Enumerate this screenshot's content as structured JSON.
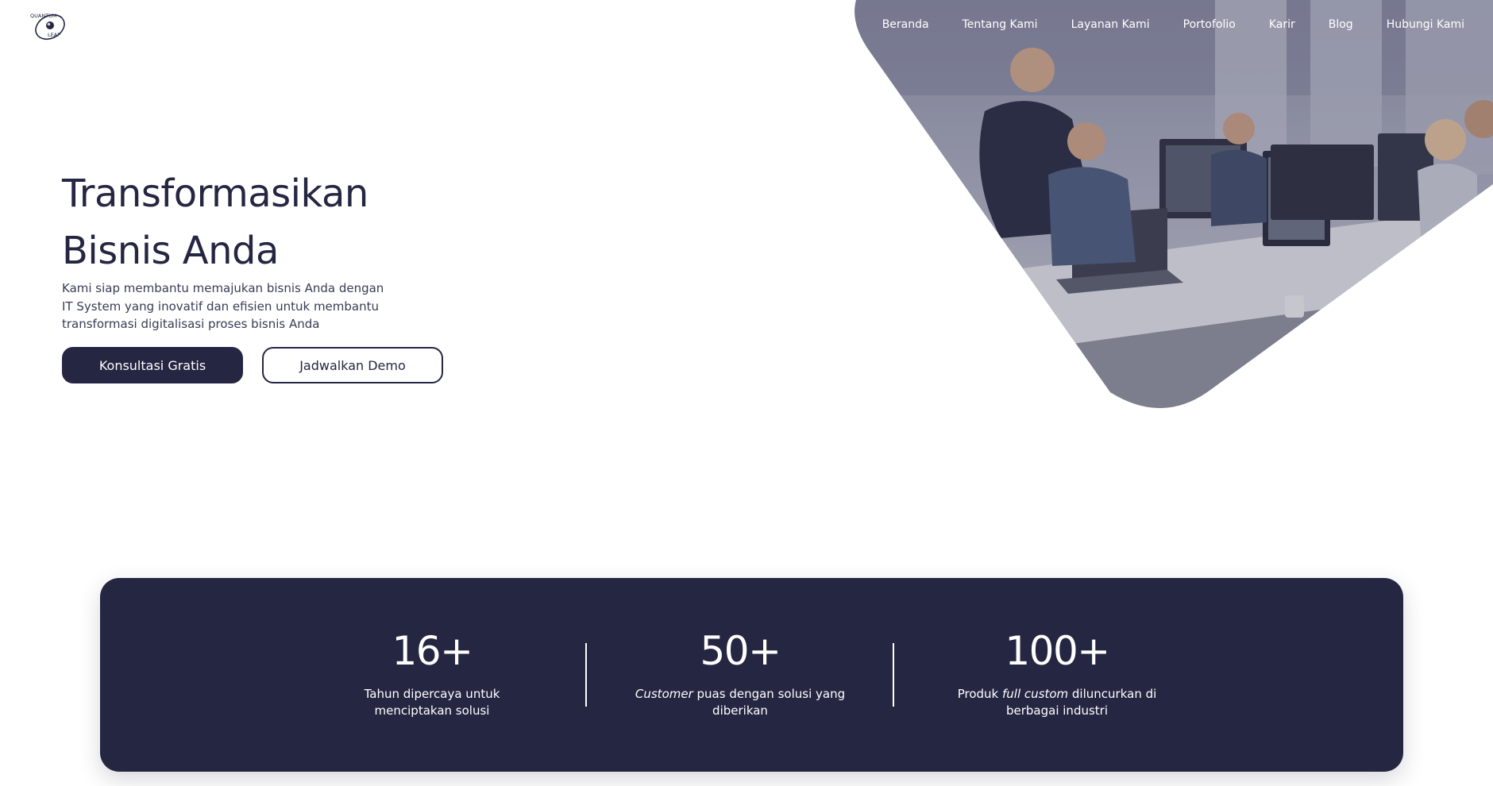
{
  "brand": {
    "logo_text_top": "QUANTUM",
    "logo_text_bottom": "LEAP"
  },
  "nav": {
    "items": [
      {
        "label": "Beranda"
      },
      {
        "label": "Tentang Kami"
      },
      {
        "label": "Layanan Kami"
      },
      {
        "label": "Portofolio"
      },
      {
        "label": "Karir"
      },
      {
        "label": "Blog"
      },
      {
        "label": "Hubungi Kami"
      }
    ]
  },
  "hero": {
    "title_line_1": "Transformasikan",
    "title_line_2": "Bisnis Anda",
    "desc_line_1": "Kami siap membantu memajukan bisnis Anda dengan",
    "desc_line_2": "IT System yang inovatif dan efisien untuk membantu",
    "desc_line_3": "transformasi digitalisasi proses bisnis Anda",
    "primary_button": "Konsultasi Gratis",
    "secondary_button": "Jadwalkan Demo"
  },
  "stats": [
    {
      "value": "16+",
      "caption_pre": "",
      "caption_em": "",
      "caption_post": "Tahun dipercaya untuk menciptakan solusi"
    },
    {
      "value": "50+",
      "caption_pre": "",
      "caption_em": "Customer",
      "caption_post": " puas dengan solusi yang diberikan"
    },
    {
      "value": "100+",
      "caption_pre": "Produk ",
      "caption_em": "full custom",
      "caption_post": " diluncurkan di berbagai industri"
    }
  ],
  "colors": {
    "navy": "#252642",
    "white": "#ffffff"
  }
}
